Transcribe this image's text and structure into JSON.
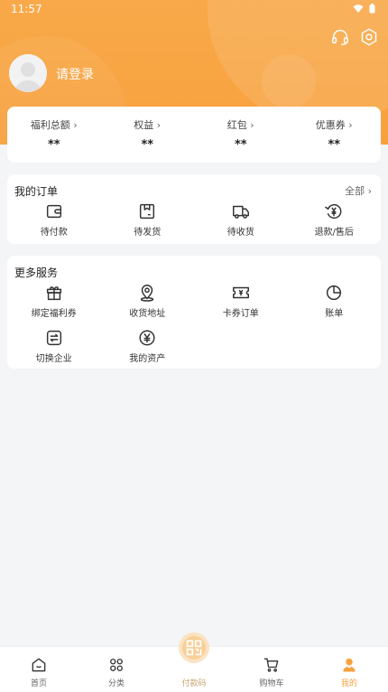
{
  "status_bar": {
    "time": "11:57"
  },
  "profile": {
    "login_prompt": "请登录"
  },
  "stats": [
    {
      "label": "福利总额",
      "value": "**"
    },
    {
      "label": "权益",
      "value": "**"
    },
    {
      "label": "红包",
      "value": "**"
    },
    {
      "label": "优惠券",
      "value": "**"
    }
  ],
  "orders": {
    "title": "我的订单",
    "more": "全部 ›",
    "items": [
      {
        "label": "待付款",
        "icon": "wallet-icon"
      },
      {
        "label": "待发货",
        "icon": "box-icon"
      },
      {
        "label": "待收货",
        "icon": "truck-icon"
      },
      {
        "label": "退款/售后",
        "icon": "refund-icon"
      }
    ]
  },
  "services": {
    "title": "更多服务",
    "items": [
      {
        "label": "绑定福利券",
        "icon": "gift-icon"
      },
      {
        "label": "收货地址",
        "icon": "location-icon"
      },
      {
        "label": "卡券订单",
        "icon": "ticket-icon"
      },
      {
        "label": "账单",
        "icon": "pie-chart-icon"
      },
      {
        "label": "切换企业",
        "icon": "switch-icon"
      },
      {
        "label": "我的资产",
        "icon": "yuan-icon"
      }
    ]
  },
  "tabbar": [
    {
      "label": "首页",
      "icon": "home-icon"
    },
    {
      "label": "分类",
      "icon": "category-icon"
    },
    {
      "label": "付款码",
      "icon": "qr-code-icon"
    },
    {
      "label": "购物车",
      "icon": "cart-icon"
    },
    {
      "label": "我的",
      "icon": "user-icon",
      "active": true
    }
  ],
  "colors": {
    "accent": "#f7a13d",
    "background": "#f4f5f7"
  }
}
